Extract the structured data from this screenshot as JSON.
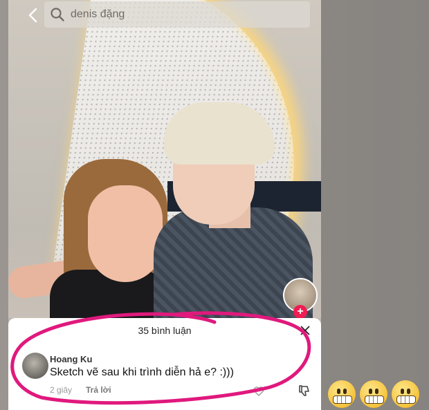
{
  "search": {
    "query": "denis đặng"
  },
  "comments_panel": {
    "title": "35 bình luận",
    "comment": {
      "username": "Hoang Ku",
      "text": "Sketch vẽ sau khi trình diễn hả e? :)))",
      "time": "2 giây",
      "reply_label": "Trả lời"
    }
  },
  "colors": {
    "highlight": "#e0197d",
    "tiktok_red": "#ee1d52"
  },
  "emojis": [
    "grimacing-face",
    "grimacing-face",
    "grimacing-face"
  ]
}
